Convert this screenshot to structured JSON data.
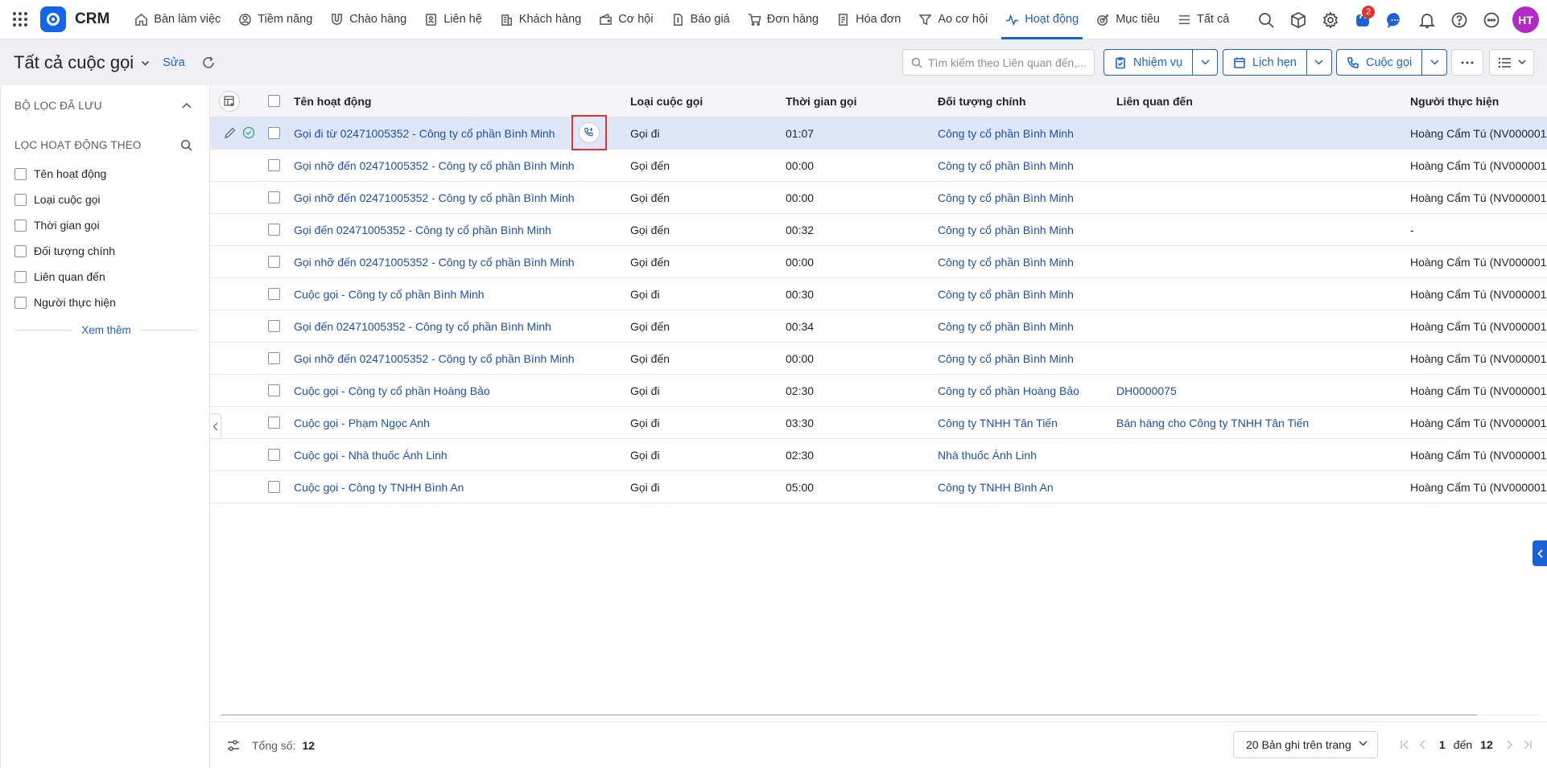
{
  "app": {
    "name": "CRM"
  },
  "nav": {
    "items": [
      {
        "label": "Bàn làm việc",
        "icon": "home-icon"
      },
      {
        "label": "Tiềm năng",
        "icon": "prospect-icon"
      },
      {
        "label": "Chào hàng",
        "icon": "magnet-icon"
      },
      {
        "label": "Liên hệ",
        "icon": "contact-icon"
      },
      {
        "label": "Khách hàng",
        "icon": "building-icon"
      },
      {
        "label": "Cơ hội",
        "icon": "wallet-icon"
      },
      {
        "label": "Báo giá",
        "icon": "quote-icon"
      },
      {
        "label": "Đơn hàng",
        "icon": "cart-icon"
      },
      {
        "label": "Hóa đơn",
        "icon": "invoice-icon"
      },
      {
        "label": "Ao cơ hội",
        "icon": "funnel-icon"
      },
      {
        "label": "Hoạt động",
        "icon": "activity-icon",
        "active": true
      },
      {
        "label": "Mục tiêu",
        "icon": "target-icon"
      },
      {
        "label": "Tất cả",
        "icon": "menu-icon"
      }
    ],
    "cart_badge": "2",
    "avatar_initials": "HT"
  },
  "header": {
    "title": "Tất cả cuộc gọi",
    "edit_label": "Sửa",
    "search_placeholder": "Tìm kiếm theo Liên quan đến,...",
    "buttons": {
      "task": "Nhiệm vụ",
      "appointment": "Lịch hẹn",
      "call": "Cuộc gọi"
    }
  },
  "filters": {
    "saved_title": "BỘ LỌC ĐÃ LƯU",
    "filter_title": "LỌC HOẠT ĐỘNG THEO",
    "items": [
      "Tên hoạt động",
      "Loại cuộc gọi",
      "Thời gian gọi",
      "Đối tượng chính",
      "Liên quan đến",
      "Người thực hiện"
    ],
    "see_more": "Xem thêm"
  },
  "table": {
    "columns": [
      "Tên hoạt động",
      "Loại cuộc gọi",
      "Thời gian gọi",
      "Đối tượng chính",
      "Liên quan đến",
      "Người thực hiện"
    ],
    "rows": [
      {
        "name": "Gọi đi từ 02471005352 - Công ty cổ phần Bình Minh",
        "type": "Gọi đi",
        "duration": "01:07",
        "main": "Công ty cổ phần Bình Minh",
        "related": "",
        "owner": "Hoàng Cẩm Tú (NV000001"
      },
      {
        "name": "Gọi nhỡ đến 02471005352 - Công ty cổ phần Bình Minh",
        "type": "Gọi đến",
        "duration": "00:00",
        "main": "Công ty cổ phần Bình Minh",
        "related": "",
        "owner": "Hoàng Cẩm Tú (NV000001"
      },
      {
        "name": "Gọi nhỡ đến 02471005352 - Công ty cổ phần Bình Minh",
        "type": "Gọi đến",
        "duration": "00:00",
        "main": "Công ty cổ phần Bình Minh",
        "related": "",
        "owner": "Hoàng Cẩm Tú (NV000001"
      },
      {
        "name": "Gọi đến 02471005352 - Công ty cổ phần Bình Minh",
        "type": "Gọi đến",
        "duration": "00:32",
        "main": "Công ty cổ phần Bình Minh",
        "related": "",
        "owner": "-"
      },
      {
        "name": "Gọi nhỡ đến 02471005352 - Công ty cổ phần Bình Minh",
        "type": "Gọi đến",
        "duration": "00:00",
        "main": "Công ty cổ phần Bình Minh",
        "related": "",
        "owner": "Hoàng Cẩm Tú (NV000001"
      },
      {
        "name": "Cuộc gọi - Công ty cổ phần Bình Minh",
        "type": "Gọi đi",
        "duration": "00:30",
        "main": "Công ty cổ phần Bình Minh",
        "related": "",
        "owner": "Hoàng Cẩm Tú (NV000001"
      },
      {
        "name": "Gọi đến 02471005352 - Công ty cổ phần Bình Minh",
        "type": "Gọi đến",
        "duration": "00:34",
        "main": "Công ty cổ phần Bình Minh",
        "related": "",
        "owner": "Hoàng Cẩm Tú (NV000001"
      },
      {
        "name": "Gọi nhỡ đến 02471005352 - Công ty cổ phần Bình Minh",
        "type": "Gọi đến",
        "duration": "00:00",
        "main": "Công ty cổ phần Bình Minh",
        "related": "",
        "owner": "Hoàng Cẩm Tú (NV000001"
      },
      {
        "name": "Cuộc gọi - Công ty cổ phần Hoàng Bảo",
        "type": "Gọi đi",
        "duration": "02:30",
        "main": "Công ty cổ phần Hoàng Bảo",
        "related": "DH0000075",
        "owner": "Hoàng Cẩm Tú (NV000001"
      },
      {
        "name": "Cuộc gọi - Phạm Ngọc Anh",
        "type": "Gọi đi",
        "duration": "03:30",
        "main": "Công ty TNHH Tân Tiến",
        "related": "Bán hàng cho Công ty TNHH Tân Tiến",
        "owner": "Hoàng Cẩm Tú (NV000001"
      },
      {
        "name": "Cuộc gọi - Nhà thuốc Ánh Linh",
        "type": "Gọi đi",
        "duration": "02:30",
        "main": "Nhà thuốc Ánh Linh",
        "related": "",
        "owner": "Hoàng Cẩm Tú (NV000001"
      },
      {
        "name": "Cuộc gọi - Công ty TNHH Bình An",
        "type": "Gọi đi",
        "duration": "05:00",
        "main": "Công ty TNHH Bình An",
        "related": "",
        "owner": "Hoàng Cẩm Tú (NV000001"
      }
    ]
  },
  "footer": {
    "total_label": "Tổng số:",
    "total_value": "12",
    "page_size": "20 Bản ghi trên trang",
    "page_from": "1",
    "page_sep": "đến",
    "page_to": "12"
  },
  "colors": {
    "accent": "#1a62d8",
    "selected_row": "#dfe6f8",
    "highlight_box": "#e53030",
    "avatar": "#b02bc5"
  }
}
